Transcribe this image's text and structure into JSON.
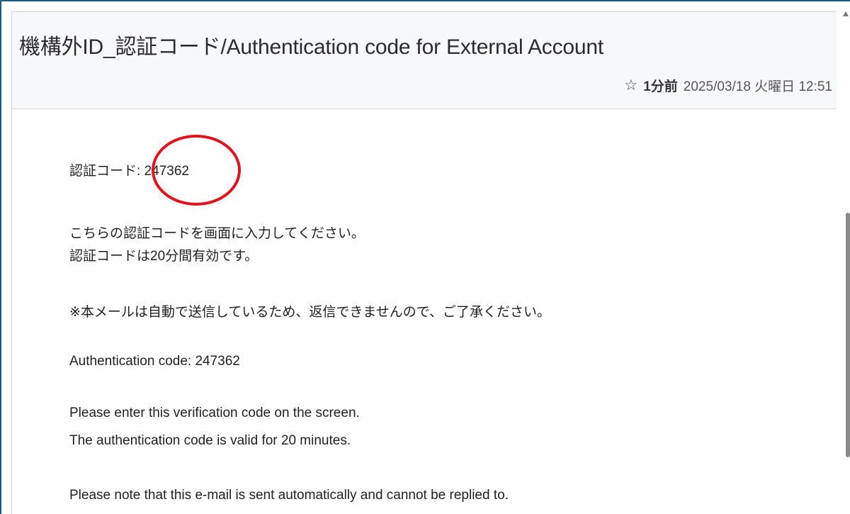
{
  "email": {
    "subject": "機構外ID_認証コード/Authentication code for External Account",
    "relative_time": "1分前",
    "date_time": "2025/03/18 火曜日 12:51",
    "icons": {
      "star": "star-outline-icon"
    },
    "highlight_color": "#e0141e",
    "body": {
      "code_label_ja": "認証コード",
      "code_value_ja": ": 247362",
      "instruction_ja_1": "こちらの認証コードを画面に入力してください。",
      "instruction_ja_2": "認証コードは20分間有効です。",
      "notice_ja": "※本メールは自動で送信しているため、返信できませんので、ご了承ください。",
      "code_line_en": "Authentication code: 247362",
      "instruction_en_1": "Please enter this verification code on the screen.",
      "instruction_en_2": "The authentication code is valid for 20 minutes.",
      "notice_en": "Please note that this e-mail is sent automatically and cannot be replied to."
    }
  }
}
